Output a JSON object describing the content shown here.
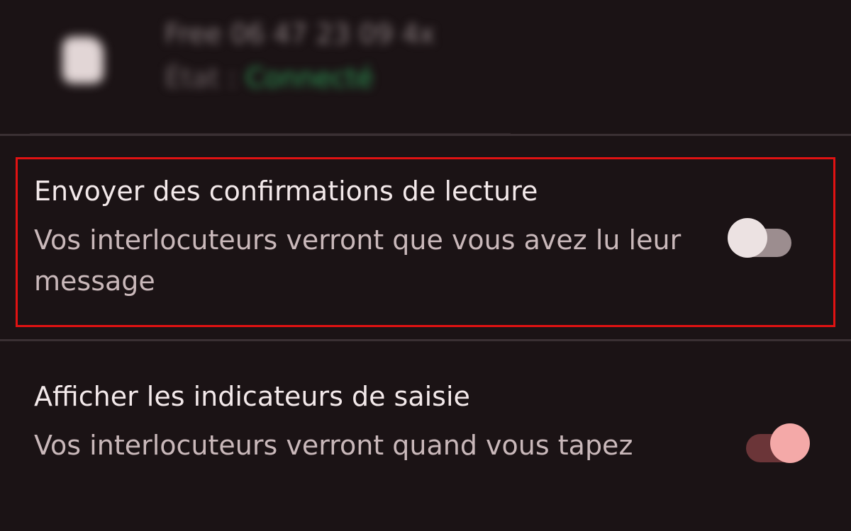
{
  "sim": {
    "name": "Free 06 47 23 09 4x",
    "status_label": "État :",
    "status_value": "Connecté"
  },
  "settings": [
    {
      "title": "Envoyer des confirmations de lecture",
      "description": "Vos interlocuteurs verront que vous avez lu leur message",
      "enabled": false
    },
    {
      "title": "Afficher les indicateurs de saisie",
      "description": "Vos interlocuteurs verront quand vous tapez",
      "enabled": true
    }
  ],
  "colors": {
    "background": "#1b1315",
    "highlight": "#e01212",
    "toggle_off_track": "#9c8d8f",
    "toggle_off_thumb": "#ece2e2",
    "toggle_on_track": "#6b3538",
    "toggle_on_thumb": "#f4a9a8",
    "connected_green": "#2e9a55"
  }
}
